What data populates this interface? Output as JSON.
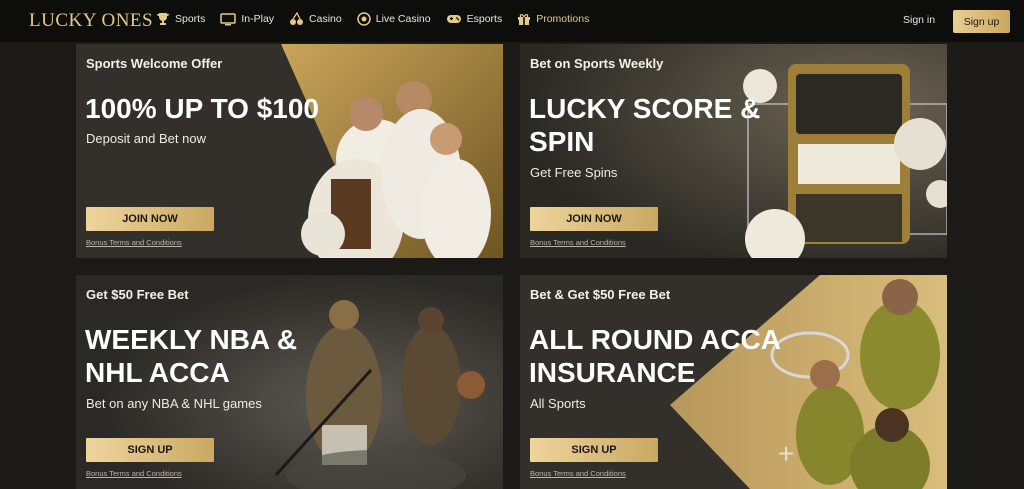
{
  "header": {
    "logo": "LUCKY ONES",
    "nav": [
      {
        "label": "Sports",
        "icon": "trophy-icon"
      },
      {
        "label": "In-Play",
        "icon": "monitor-icon"
      },
      {
        "label": "Casino",
        "icon": "cherries-icon"
      },
      {
        "label": "Live Casino",
        "icon": "chip-icon"
      },
      {
        "label": "Esports",
        "icon": "gamepad-icon"
      },
      {
        "label": "Promotions",
        "icon": "gift-icon"
      }
    ],
    "signin": "Sign in",
    "signup": "Sign up"
  },
  "colors": {
    "gold": "#e4c989",
    "card_bg": "#33302b",
    "page_bg": "#1b1a17"
  },
  "promos": [
    {
      "eyebrow": "Sports Welcome Offer",
      "headline": "100% UP TO $100",
      "sub": "Deposit and Bet now",
      "cta": "JOIN NOW",
      "terms": "Bonus Terms and Conditions"
    },
    {
      "eyebrow": "Bet on Sports Weekly",
      "headline": "LUCKY SCORE &\nSPIN",
      "sub": "Get Free Spins",
      "cta": "JOIN NOW",
      "terms": "Bonus Terms and Conditions"
    },
    {
      "eyebrow": "Get $50 Free Bet",
      "headline": "WEEKLY NBA &\nNHL ACCA",
      "sub": "Bet on any NBA & NHL games",
      "cta": "SIGN UP",
      "terms": "Bonus Terms and Conditions"
    },
    {
      "eyebrow": "Bet & Get $50 Free Bet",
      "headline": "ALL ROUND ACCA\nINSURANCE",
      "sub": "All Sports",
      "cta": "SIGN UP",
      "terms": "Bonus Terms and Conditions"
    }
  ]
}
